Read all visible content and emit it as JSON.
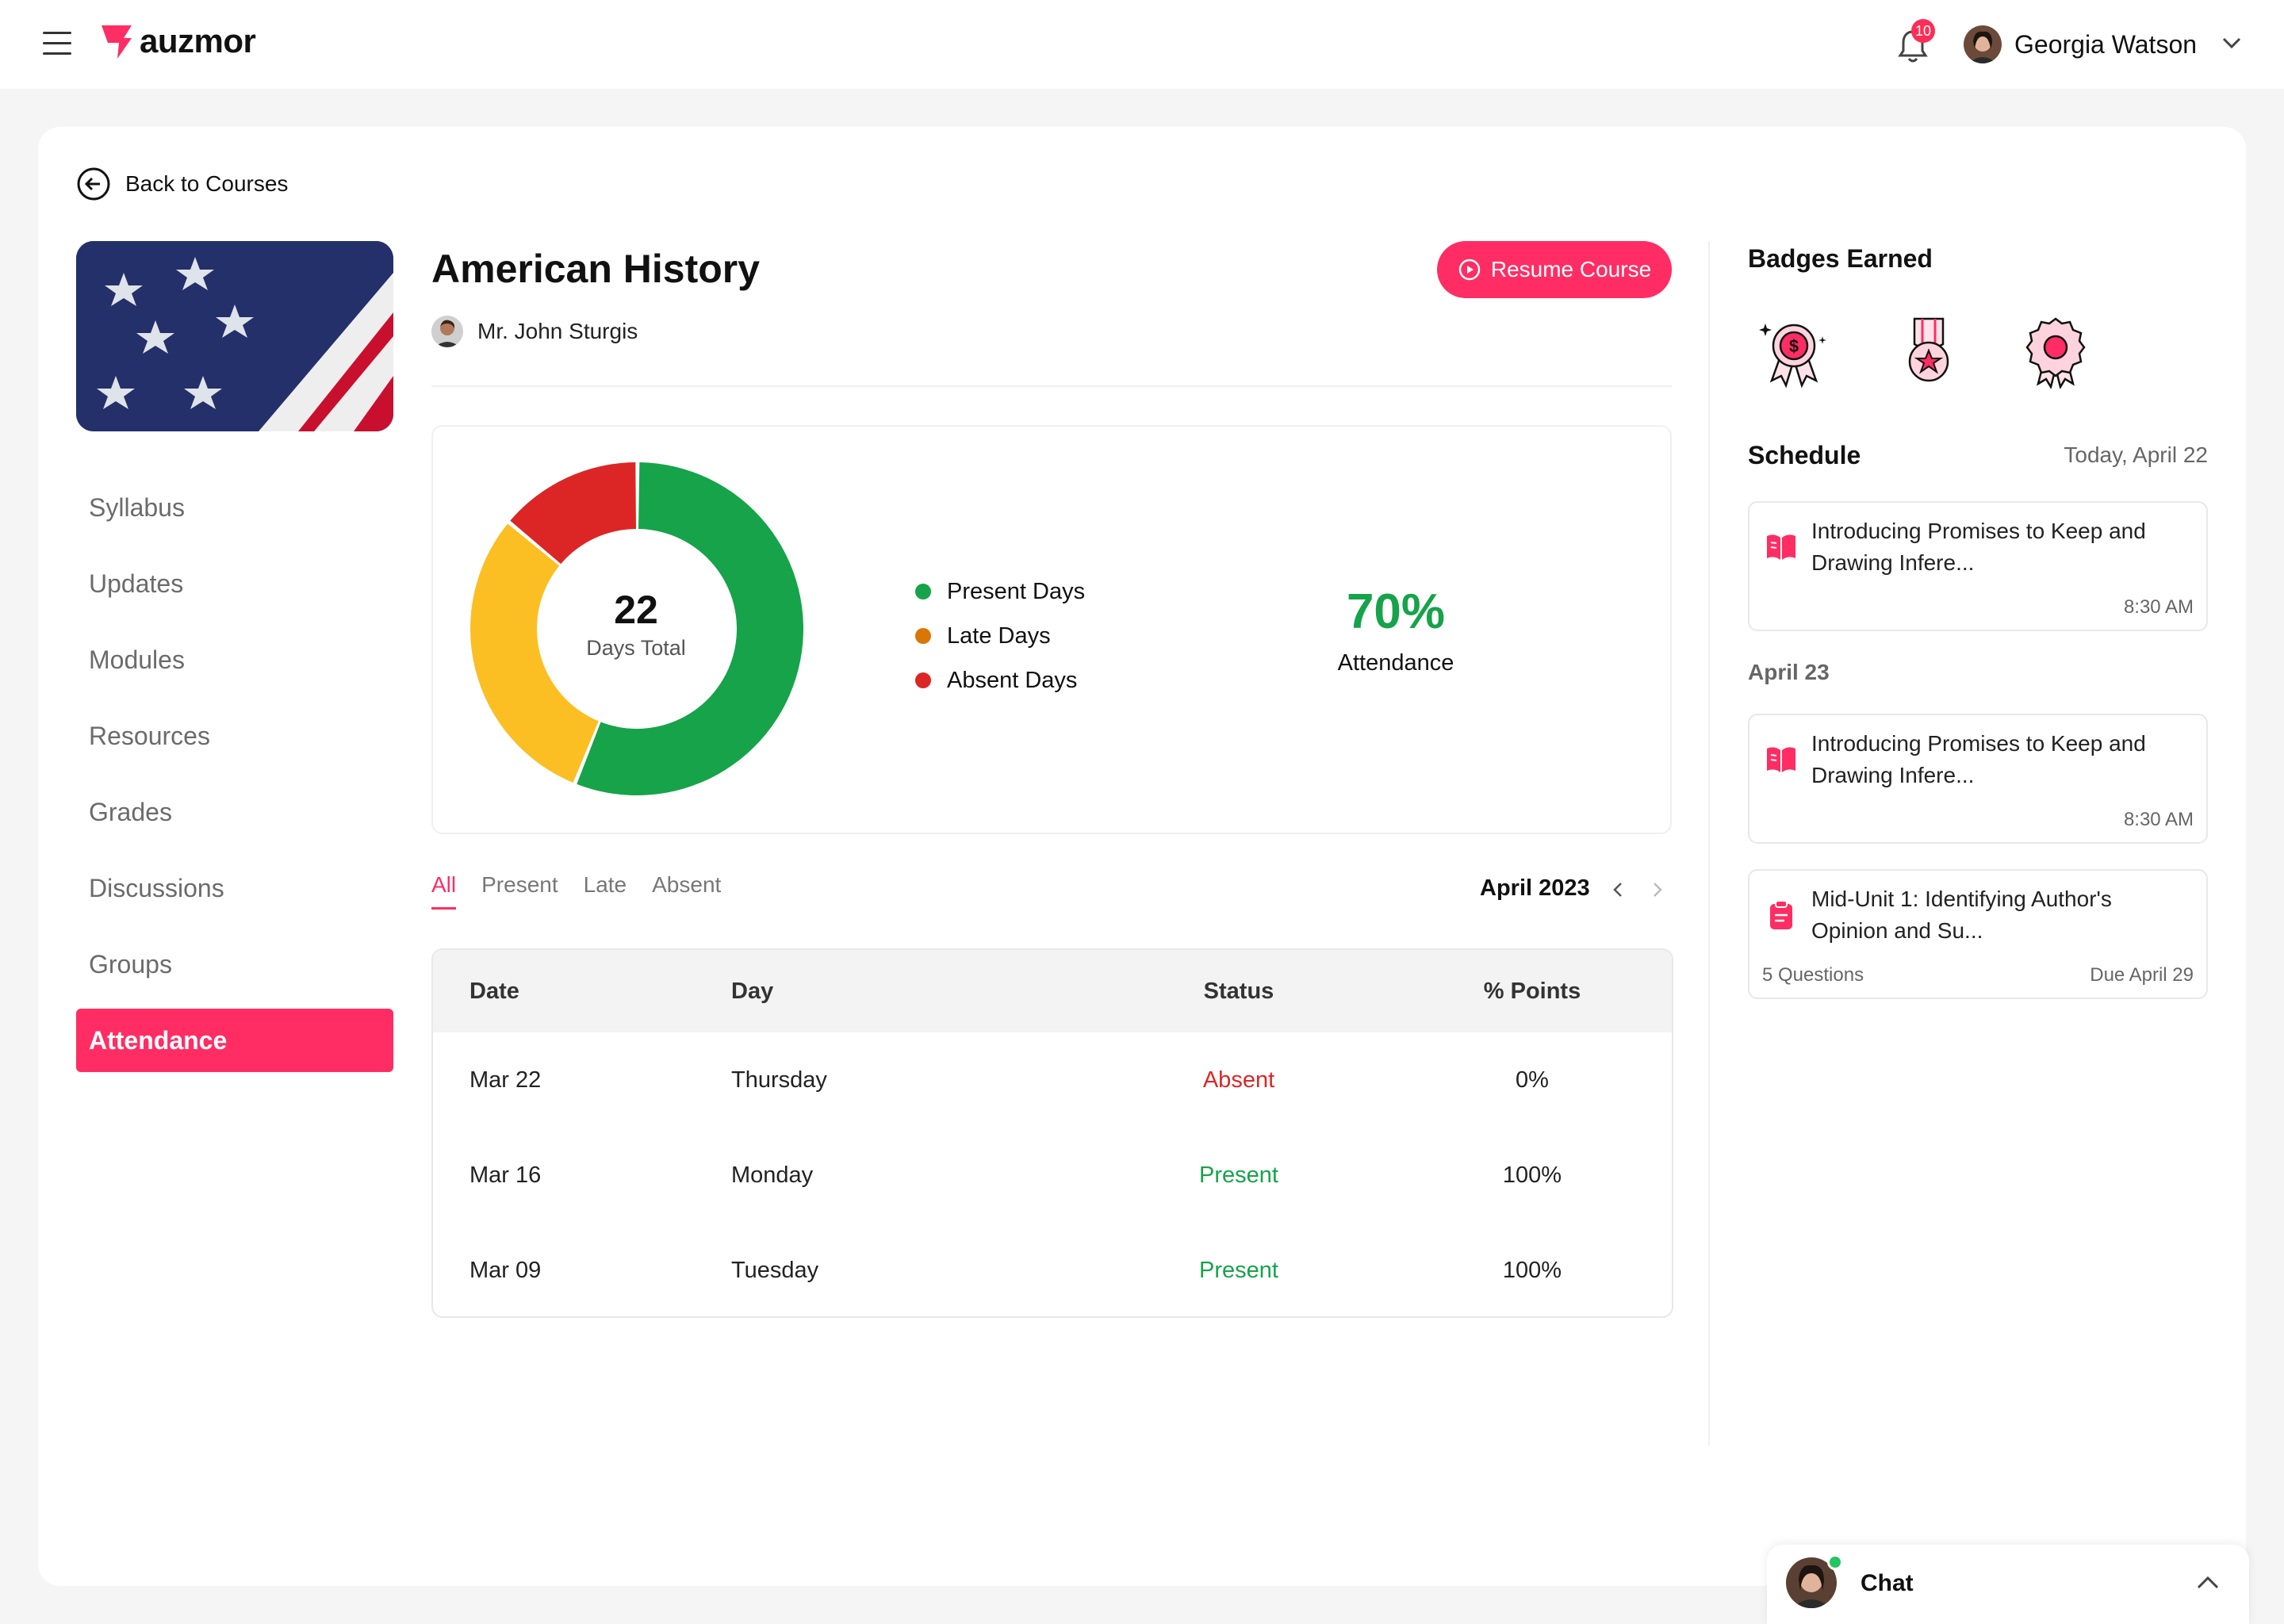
{
  "app": {
    "logo_text": "auzmor",
    "notifications_count": "10",
    "user_name": "Georgia Watson",
    "accent_color": "#ff2d63"
  },
  "nav": {
    "back_label": "Back to Courses",
    "items": [
      {
        "label": "Syllabus"
      },
      {
        "label": "Updates"
      },
      {
        "label": "Modules"
      },
      {
        "label": "Resources"
      },
      {
        "label": "Grades"
      },
      {
        "label": "Discussions"
      },
      {
        "label": "Groups"
      },
      {
        "label": "Attendance",
        "active": true
      }
    ]
  },
  "course": {
    "title": "American History",
    "instructor": "Mr. John Sturgis",
    "resume_label": "Resume Course"
  },
  "stats": {
    "total_days": "22",
    "total_label": "Days Total",
    "attendance_pct": "70%",
    "attendance_label": "Attendance",
    "legend": [
      {
        "label": "Present Days",
        "color": "#16a34a"
      },
      {
        "label": "Late Days",
        "color": "#d97706"
      },
      {
        "label": "Absent Days",
        "color": "#dc2626"
      }
    ],
    "segments": [
      {
        "name": "Present",
        "fraction": 0.56,
        "color": "#16a34a"
      },
      {
        "name": "Late",
        "fraction": 0.3,
        "color": "#fbbf24"
      },
      {
        "name": "Absent",
        "fraction": 0.14,
        "color": "#dc2626"
      }
    ]
  },
  "filters": {
    "tabs": [
      "All",
      "Present",
      "Late",
      "Absent"
    ],
    "active_tab": "All",
    "month": "April 2023"
  },
  "table": {
    "headers": {
      "date": "Date",
      "day": "Day",
      "status": "Status",
      "points": "% Points"
    },
    "rows": [
      {
        "date": "Mar 22",
        "day": "Thursday",
        "status": "Absent",
        "points": "0%"
      },
      {
        "date": "Mar 16",
        "day": "Monday",
        "status": "Present",
        "points": "100%"
      },
      {
        "date": "Mar 09",
        "day": "Tuesday",
        "status": "Present",
        "points": "100%"
      }
    ]
  },
  "sidebar": {
    "badges_title": "Badges Earned",
    "badges": [
      "dollar-medal-icon",
      "star-medal-icon",
      "rosette-icon"
    ],
    "schedule_title": "Schedule",
    "schedule_date": "Today, April 22",
    "day2_label": "April 23",
    "items": [
      {
        "text": "Introducing Promises to Keep and Drawing Infere...",
        "time": "8:30 AM",
        "icon": "book-icon"
      },
      {
        "text": "Introducing Promises to Keep and Drawing Infere...",
        "time": "8:30 AM",
        "icon": "book-icon"
      },
      {
        "text": "Mid-Unit 1: Identifying Author's Opinion and Su...",
        "meta": "5 Questions",
        "due": "Due April 29",
        "icon": "clipboard-icon"
      }
    ]
  },
  "chat": {
    "label": "Chat"
  }
}
